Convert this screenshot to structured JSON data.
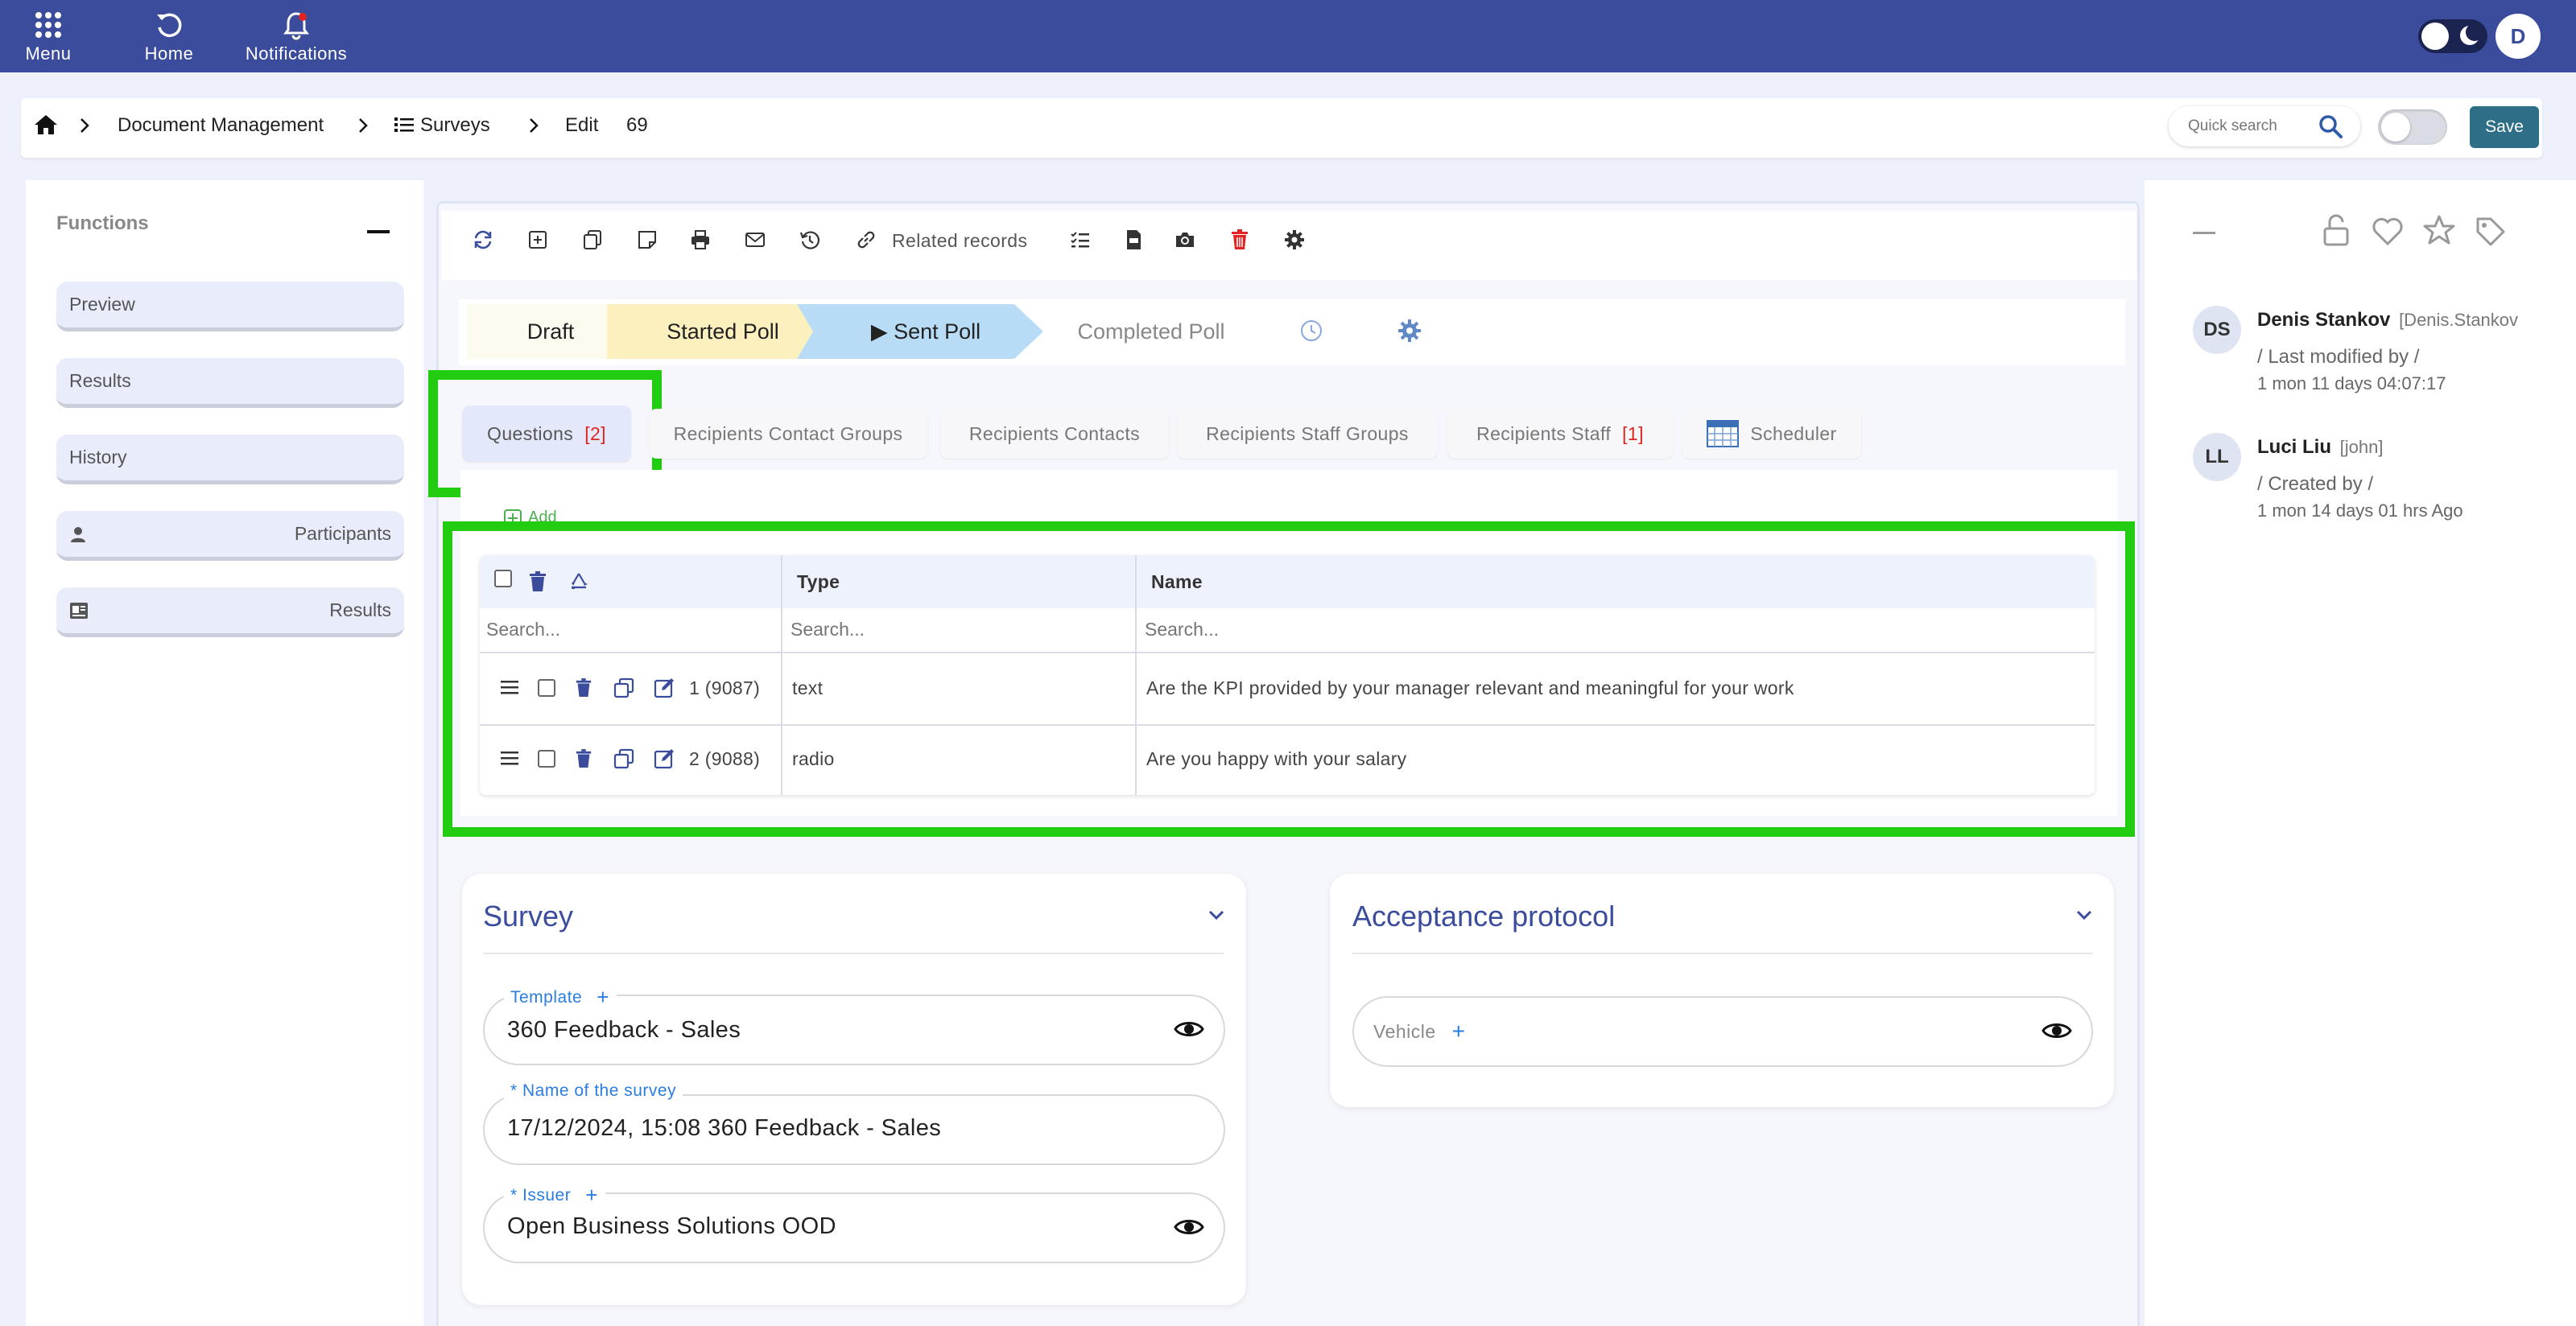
{
  "topbar": {
    "menu_label": "Menu",
    "home_label": "Home",
    "notifications_label": "Notifications",
    "user_initial": "D"
  },
  "breadcrumb": {
    "item1": "Document Management",
    "item2": "Surveys",
    "item3": "Edit",
    "record_id": "69"
  },
  "search": {
    "placeholder": "Quick search"
  },
  "save_label": "Save",
  "functions": {
    "title": "Functions",
    "items": [
      "Preview",
      "Results",
      "History",
      "Participants",
      "Results"
    ]
  },
  "toolbar": {
    "related_records": "Related records"
  },
  "stages": [
    "Draft",
    "Started Poll",
    "▶ Sent Poll",
    "Completed Poll"
  ],
  "tabs": {
    "questions": "Questions",
    "questions_count": "[2]",
    "contact_groups": "Recipients Contact Groups",
    "contacts": "Recipients Contacts",
    "staff_groups": "Recipients Staff Groups",
    "staff": "Recipients Staff",
    "staff_count": "[1]",
    "scheduler": "Scheduler"
  },
  "add_label": "Add",
  "table": {
    "columns": [
      "",
      "Type",
      "Name"
    ],
    "search_placeholder": "Search...",
    "rows": [
      {
        "num": "1 (9087)",
        "type": "text",
        "name": "Are the KPI provided by your manager relevant and meaningful for your work"
      },
      {
        "num": "2 (9088)",
        "type": "radio",
        "name": "Are you happy with your salary"
      }
    ]
  },
  "survey_card": {
    "title": "Survey",
    "template_label": "Template",
    "template_value": "360 Feedback - Sales",
    "name_label": "* Name of the survey",
    "name_value": "17/12/2024, 15:08 360 Feedback - Sales",
    "issuer_label": "* Issuer",
    "issuer_value": "Open Business Solutions OOD"
  },
  "acceptance_card": {
    "title": "Acceptance protocol",
    "vehicle_label": "Vehicle"
  },
  "activity": [
    {
      "initials": "DS",
      "name": "Denis Stankov",
      "username": "[Denis.Stankov",
      "action": "/ Last modified by /",
      "time": "1 mon 11 days 04:07:17"
    },
    {
      "initials": "LL",
      "name": "Luci Liu",
      "username": "[john]",
      "action": "/ Created by /",
      "time": "1 mon 14 days 01 hrs Ago"
    }
  ],
  "colors": {
    "topbar": "#3a4c9b",
    "highlight": "#22cc11",
    "save": "#2e6f87",
    "delete": "#e02424"
  }
}
